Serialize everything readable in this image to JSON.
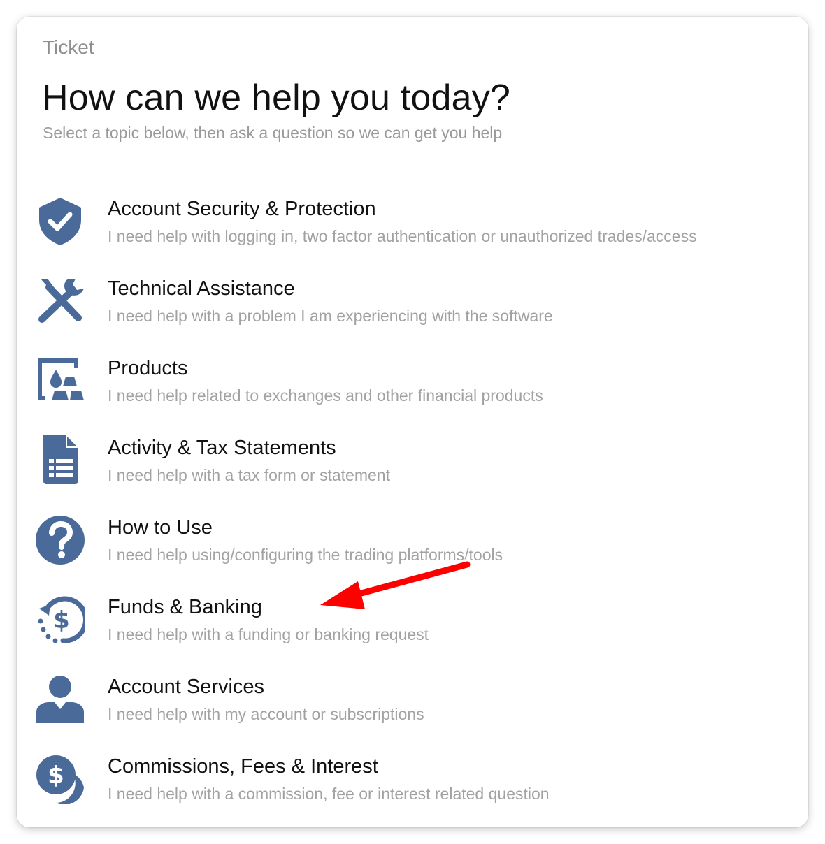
{
  "header": {
    "eyebrow": "Ticket",
    "title": "How can we help you today?",
    "subtitle": "Select a topic below, then ask a question so we can get you help"
  },
  "colors": {
    "icon": "#4a6a9a",
    "title": "#111111",
    "muted": "#a2a2a2",
    "annotation_arrow": "#ff0000"
  },
  "topics": [
    {
      "icon": "shield-check-icon",
      "label": "Account Security & Protection",
      "desc": "I need help with logging in, two factor authentication or unauthorized trades/access"
    },
    {
      "icon": "wrench-screwdriver-icon",
      "label": "Technical Assistance",
      "desc": "I need help with a problem I am experiencing with the software"
    },
    {
      "icon": "commodities-icon",
      "label": "Products",
      "desc": "I need help related to exchanges and other financial products"
    },
    {
      "icon": "document-list-icon",
      "label": "Activity & Tax Statements",
      "desc": "I need help with a tax form or statement"
    },
    {
      "icon": "question-circle-icon",
      "label": "How to Use",
      "desc": "I need help using/configuring the trading platforms/tools"
    },
    {
      "icon": "dollar-history-icon",
      "label": "Funds & Banking",
      "desc": "I need help with a funding or banking request"
    },
    {
      "icon": "user-icon",
      "label": "Account Services",
      "desc": "I need help with my account or subscriptions"
    },
    {
      "icon": "coins-icon",
      "label": "Commissions, Fees & Interest",
      "desc": "I need help with a commission, fee or interest related question"
    }
  ]
}
